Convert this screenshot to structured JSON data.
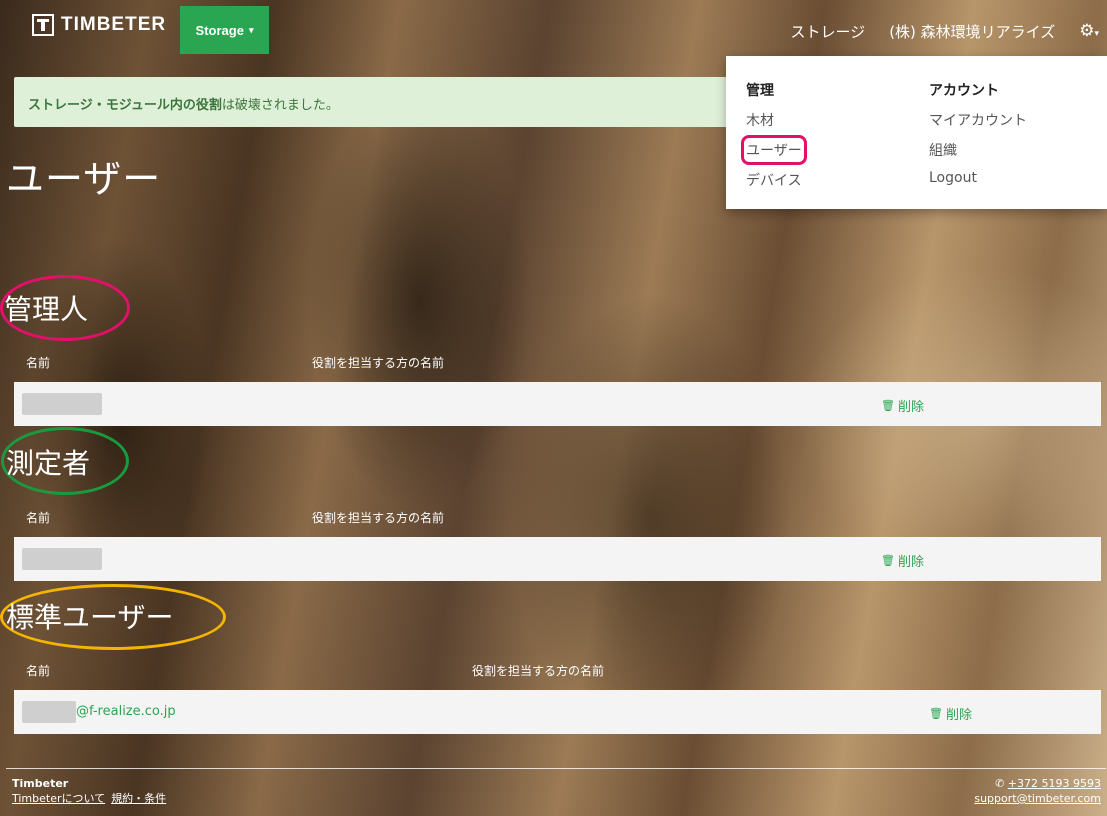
{
  "header": {
    "logo_text": "TIMBETER",
    "storage_label": "Storage",
    "storage_caret": "▾",
    "nav_storage": "ストレージ",
    "org_name": "(株) 森林環境リアライズ",
    "gear_icon": "⚙",
    "gear_caret": "▾"
  },
  "alert": {
    "bold": "ストレージ・モジュール内の役割",
    "rest": "は破壊されました。"
  },
  "page_title": "ユーザー",
  "dropdown": {
    "manage_header": "管理",
    "manage_items": [
      "木材",
      "ユーザー",
      "デバイス"
    ],
    "account_header": "アカウント",
    "account_items": [
      "マイアカウント",
      "組織",
      "Logout"
    ]
  },
  "sections": [
    {
      "title": "管理人",
      "col_name": "名前",
      "col_role": "役割を担当する方の名前",
      "row": {
        "name": "",
        "delete_label": "削除"
      }
    },
    {
      "title": "測定者",
      "col_name": "名前",
      "col_role": "役割を担当する方の名前",
      "row": {
        "name": "",
        "delete_label": "削除"
      }
    },
    {
      "title": "標準ユーザー",
      "col_name": "名前",
      "col_role": "役割を担当する方の名前",
      "row": {
        "name": "@f-realize.co.jp",
        "delete_label": "削除"
      }
    }
  ],
  "annotation_colors": {
    "users_menu": "#e3106a",
    "admin": "#e3106a",
    "measurer": "#1a9a3f",
    "standard": "#f4b400"
  },
  "footer": {
    "brand": "Timbeter",
    "link_about": "Timbeterについて",
    "link_terms": "規約・条件",
    "phone": "+372 5193 9593",
    "email": "support@timbeter.com"
  }
}
